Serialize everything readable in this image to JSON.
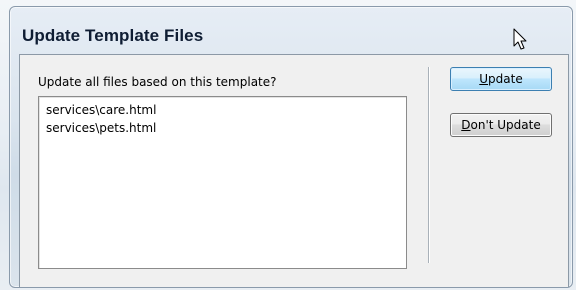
{
  "dialog": {
    "title": "Update Template Files",
    "prompt": "Update all files based on this template?",
    "files": [
      "services\\care.html",
      "services\\pets.html"
    ]
  },
  "buttons": {
    "update": {
      "mnemonic": "U",
      "rest": "pdate"
    },
    "dont_update": {
      "mnemonic": "D",
      "rest": "on't Update"
    }
  },
  "cursor_icon": "arrow-pointer-icon"
}
